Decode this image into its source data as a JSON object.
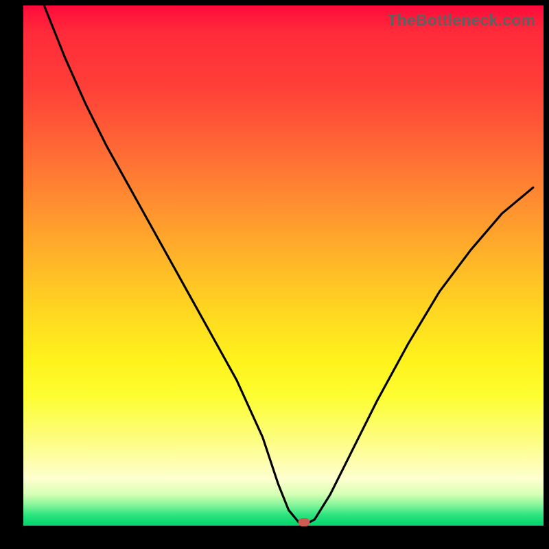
{
  "attribution": "TheBottleneck.com",
  "colors": {
    "gradient_top": "#ff0a3a",
    "gradient_mid1": "#ff8e30",
    "gradient_mid2": "#fff21c",
    "gradient_bottom": "#03d46a",
    "curve": "#000000",
    "marker": "#cc5b54",
    "frame": "#000000"
  },
  "chart_data": {
    "type": "line",
    "title": "",
    "xlabel": "",
    "ylabel": "",
    "xlim": [
      0,
      100
    ],
    "ylim": [
      0,
      100
    ],
    "grid": false,
    "legend": false,
    "series": [
      {
        "name": "bottleneck-curve",
        "x": [
          4,
          8,
          12,
          16,
          21,
          26,
          31,
          36,
          41,
          46,
          49,
          51,
          53,
          54.5,
          56,
          59,
          63,
          68,
          74,
          80,
          86,
          92,
          98
        ],
        "values": [
          100,
          90,
          81,
          73,
          64,
          55,
          46,
          37,
          28,
          17,
          8,
          3,
          0.6,
          0.4,
          1.2,
          6,
          14,
          24,
          35,
          45,
          53,
          60,
          65
        ]
      }
    ],
    "marker": {
      "x": 54,
      "y": 0.7
    }
  }
}
